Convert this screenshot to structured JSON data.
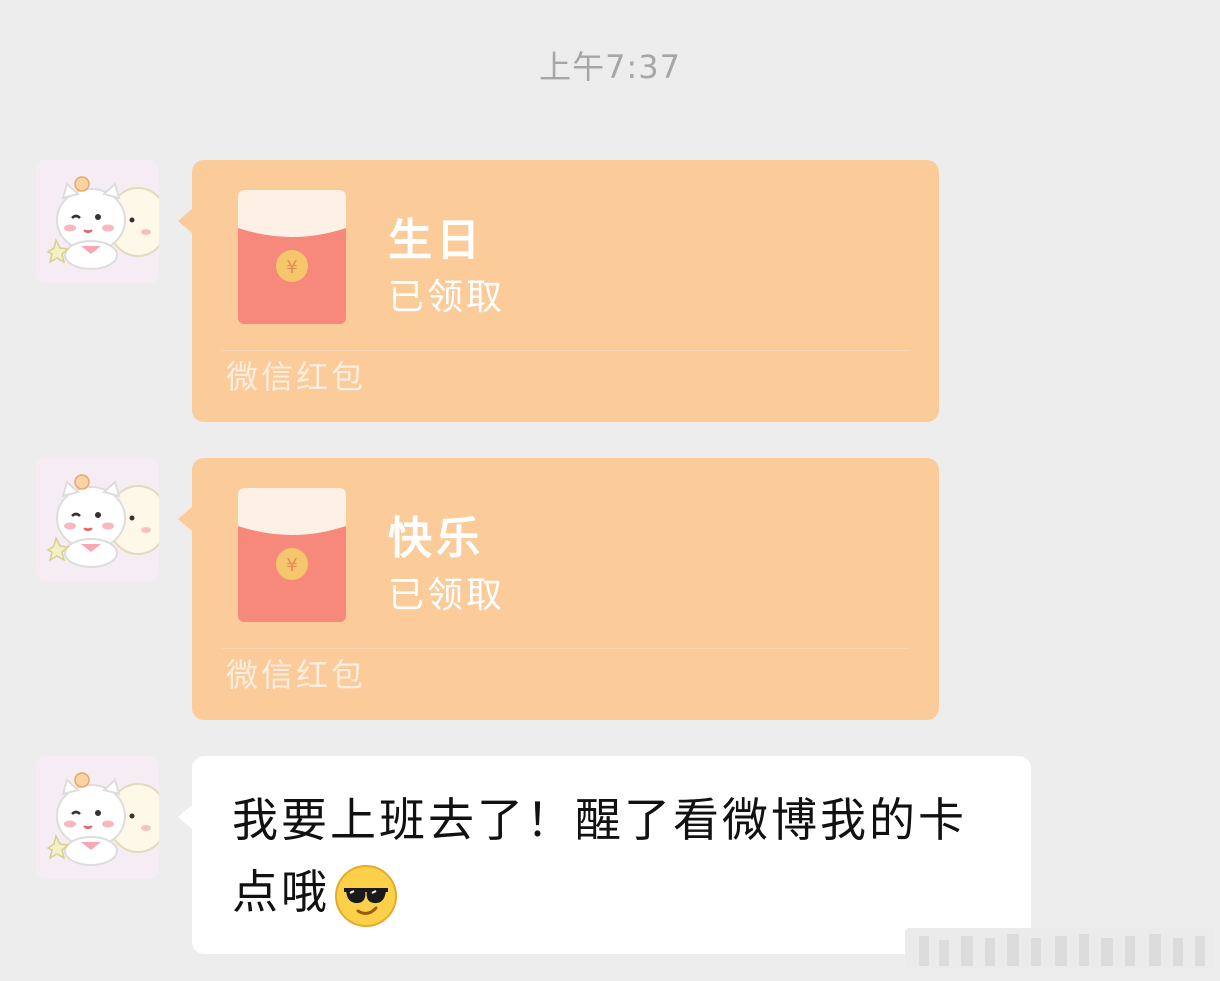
{
  "chat": {
    "timestamp": "上午7:37",
    "messages": [
      {
        "type": "red-packet",
        "title": "生日",
        "status": "已领取",
        "brand": "微信红包"
      },
      {
        "type": "red-packet",
        "title": "快乐",
        "status": "已领取",
        "brand": "微信红包"
      },
      {
        "type": "text",
        "text": "我要上班去了！醒了看微博我的卡点哦",
        "emoji": "sunglasses-emoji"
      }
    ]
  },
  "colors": {
    "background": "#ededed",
    "red_packet_bubble": "#fbcb9a",
    "envelope_body": "#f6897b",
    "envelope_flap": "#fdf1e6",
    "coin": "#f5c66b",
    "text_bubble": "#ffffff",
    "timestamp_text": "#a6a6a6"
  },
  "icons": {
    "avatar": "cat-cartoon-avatar",
    "envelope": "red-envelope-icon",
    "coin": "yuan-coin-icon"
  }
}
